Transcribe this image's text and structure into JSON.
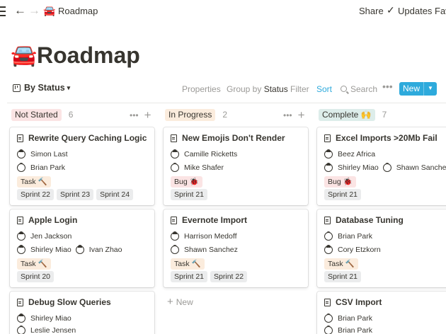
{
  "topbar": {
    "title": "Roadmap",
    "emoji": "🚘",
    "back": "←",
    "forward": "→",
    "share": "Share",
    "check": "✓",
    "updates": "Updates",
    "fav": "Fav"
  },
  "page": {
    "emoji": "🚘",
    "title": "Roadmap"
  },
  "toolbar": {
    "view_label": "By Status",
    "chevron": "⌄",
    "properties": "Properties",
    "group_by": "Group by ",
    "group_value": "Status",
    "filter": "Filter",
    "sort": "Sort",
    "search": "Search",
    "more": "•••",
    "new_label": "New",
    "new_drop": "▼"
  },
  "colors": {
    "accent": "#2eaadc",
    "not_started": "#fbe4e4",
    "in_progress": "#fbecdd",
    "complete": "#ddedea",
    "text": "#37352f",
    "muted": "#9b9a97"
  },
  "columns": [
    {
      "name": "Not Started",
      "count": "6",
      "cards": [
        {
          "title": "Rewrite Query Caching Logic",
          "people": [
            [
              "Simon Last"
            ],
            [
              "Brian Park"
            ]
          ],
          "type": "Task 🔨",
          "sprints": [
            "Sprint 22",
            "Sprint 23",
            "Sprint 24"
          ]
        },
        {
          "title": "Apple Login",
          "people": [
            [
              "Jen Jackson"
            ],
            [
              "Shirley Miao",
              "Ivan Zhao"
            ]
          ],
          "type": "Task 🔨",
          "sprints": [
            "Sprint 20"
          ]
        },
        {
          "title": "Debug Slow Queries",
          "people": [
            [
              "Shirley Miao"
            ],
            [
              "Leslie Jensen"
            ]
          ]
        }
      ]
    },
    {
      "name": "In Progress",
      "count": "2",
      "cards": [
        {
          "title": "New Emojis Don't Render",
          "people": [
            [
              "Camille Ricketts"
            ],
            [
              "Mike Shafer"
            ]
          ],
          "type": "Bug 🐞",
          "sprints": [
            "Sprint 21"
          ]
        },
        {
          "title": "Evernote Import",
          "people": [
            [
              "Harrison Medoff"
            ],
            [
              "Shawn Sanchez"
            ]
          ],
          "type": "Task 🔨",
          "sprints": [
            "Sprint 21",
            "Sprint 22"
          ]
        }
      ],
      "add_new": "New"
    },
    {
      "name": "Complete 🙌",
      "count": "7",
      "cards": [
        {
          "title": "Excel Imports >20Mb Fail",
          "people": [
            [
              "Beez Africa"
            ],
            [
              "Shirley Miao",
              "Shawn Sanchez"
            ]
          ],
          "type": "Bug 🐞",
          "sprints": [
            "Sprint 21"
          ]
        },
        {
          "title": "Database Tuning",
          "people": [
            [
              "Brian Park"
            ],
            [
              "Cory Etzkorn"
            ]
          ],
          "type": "Task 🔨",
          "sprints": [
            "Sprint 21"
          ]
        },
        {
          "title": "CSV Import",
          "people": [
            [
              "Brian Park"
            ],
            [
              "Brian Park"
            ]
          ]
        }
      ]
    }
  ],
  "icons": {
    "menu": "menu-icon",
    "doc": "page-icon",
    "avatar": "avatar-icon",
    "search": "search-icon",
    "view": "board-view-icon"
  }
}
